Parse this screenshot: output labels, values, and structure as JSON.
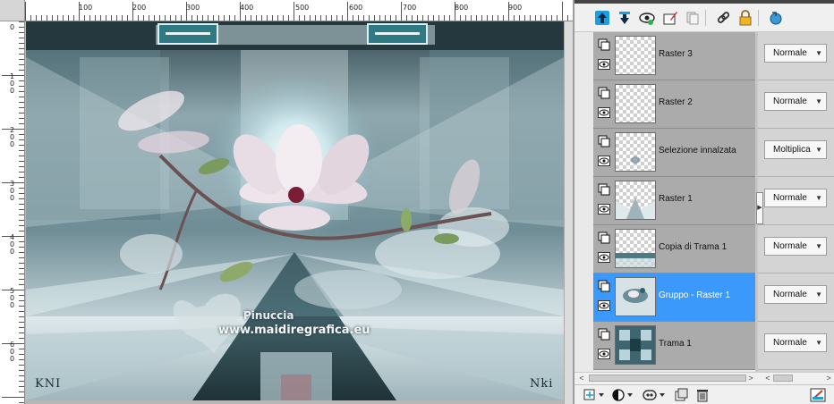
{
  "ruler": {
    "top_labels": [
      "100",
      "200",
      "300",
      "400",
      "500",
      "600",
      "700",
      "800",
      "900"
    ],
    "left_labels": [
      "0",
      "1 0 0",
      "2 0 0",
      "3 0 0",
      "4 0 0",
      "5 0 0",
      "6 0 0"
    ]
  },
  "canvas": {
    "watermark_line1": "Pinuccia",
    "watermark_line2": "www.maidiregrafica.eu",
    "signature_left": "KNI",
    "signature_right": "Nki"
  },
  "layers_toolbar": {
    "icons": [
      "move-layer-up-icon",
      "move-layer-down-icon",
      "visibility-toggle-icon",
      "edit-layer-icon",
      "copy-layer-icon",
      "link-icon",
      "lock-icon",
      "refresh-icon"
    ]
  },
  "layers": [
    {
      "name": "Raster 3",
      "blend": "Normale",
      "selected": false
    },
    {
      "name": "Raster 2",
      "blend": "Normale",
      "selected": false
    },
    {
      "name": "Selezione innalzata",
      "blend": "Moltiplica",
      "selected": false
    },
    {
      "name": "Raster 1",
      "blend": "Normale",
      "selected": false
    },
    {
      "name": "Copia di Trama 1",
      "blend": "Normale",
      "selected": false
    },
    {
      "name": "Gruppo - Raster 1",
      "blend": "Normale",
      "selected": true
    },
    {
      "name": "Trama 1",
      "blend": "Normale",
      "selected": false
    }
  ],
  "colors": {
    "selected_row": "#3b99fc",
    "row_background": "#ababab",
    "canvas_teal": "#4c6a74"
  }
}
